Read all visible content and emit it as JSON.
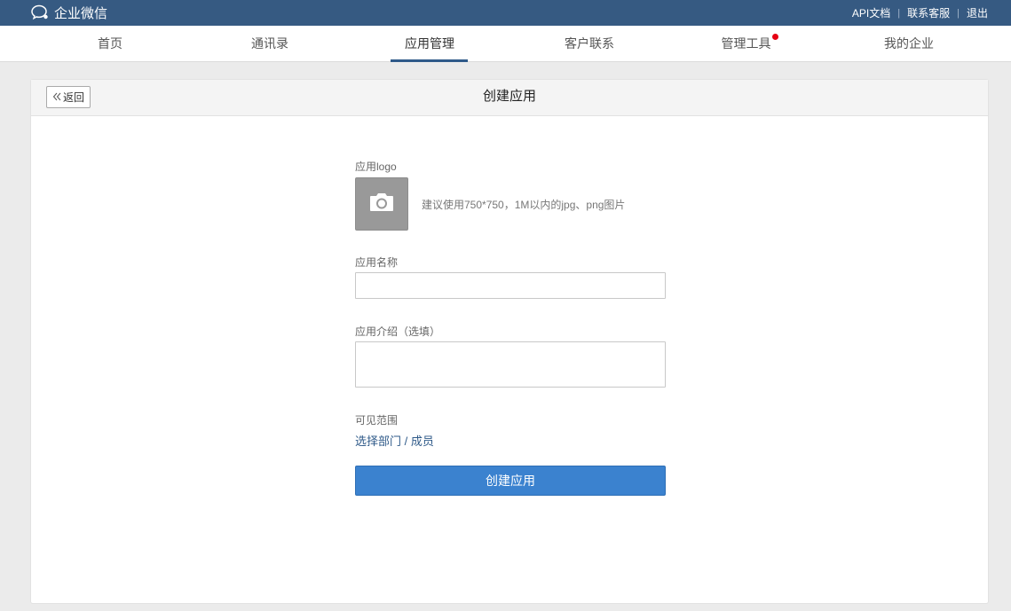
{
  "topbar": {
    "brand": "企业微信",
    "links": [
      "API文档",
      "联系客服",
      "退出"
    ]
  },
  "nav": {
    "items": [
      {
        "label": "首页"
      },
      {
        "label": "通讯录"
      },
      {
        "label": "应用管理"
      },
      {
        "label": "客户联系"
      },
      {
        "label": "管理工具"
      },
      {
        "label": "我的企业"
      }
    ],
    "active_index": 2
  },
  "panel": {
    "back_label": "返回",
    "title": "创建应用"
  },
  "form": {
    "logo_label": "应用logo",
    "logo_hint": "建议使用750*750，1M以内的jpg、png图片",
    "name_label": "应用名称",
    "name_value": "",
    "intro_label": "应用介绍（选填）",
    "intro_value": "",
    "scope_label": "可见范围",
    "scope_link": "选择部门 / 成员",
    "submit_label": "创建应用"
  },
  "colors": {
    "topbar": "#365a82",
    "accent": "#3b82cf",
    "link": "#2f5a89",
    "badge": "#e60012"
  },
  "icons": {
    "brand": "chat-bubble-icon",
    "back": "double-chevron-left-icon",
    "logo_upload": "camera-icon",
    "badge": "notification-dot-icon"
  }
}
